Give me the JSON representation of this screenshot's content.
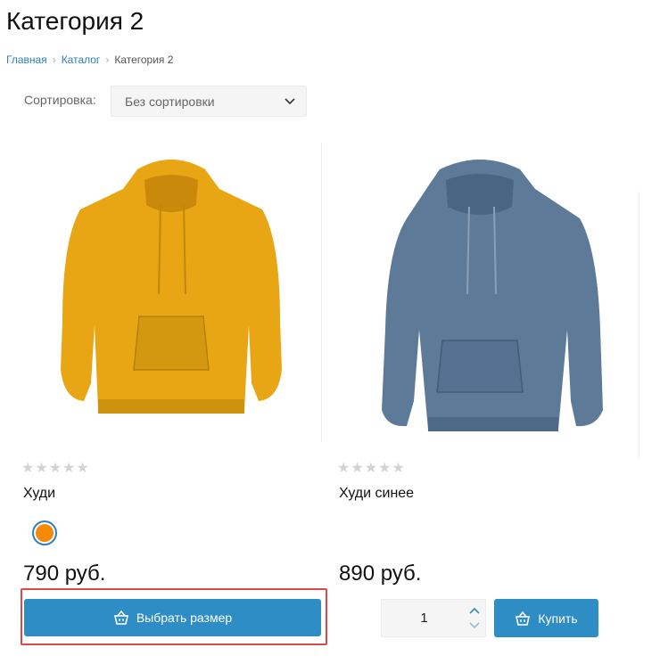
{
  "page": {
    "title": "Категория 2"
  },
  "breadcrumb": {
    "items": [
      "Главная",
      "Каталог"
    ],
    "current": "Категория 2"
  },
  "sort": {
    "label": "Сортировка:",
    "selected": "Без сортировки"
  },
  "products": [
    {
      "name": "Худи",
      "price": "790 руб.",
      "rating_stars": 0,
      "color": "#f58a09",
      "image_color": "#e8a614",
      "button_label": "Выбрать размер"
    },
    {
      "name": "Худи синее",
      "price": "890 руб.",
      "rating_stars": 0,
      "image_color": "#5d7a99",
      "quantity": "1",
      "button_label": "Купить"
    }
  ],
  "colors": {
    "accent": "#2f8dc6",
    "highlight": "#e04848",
    "star_empty": "#d3d3d3"
  }
}
